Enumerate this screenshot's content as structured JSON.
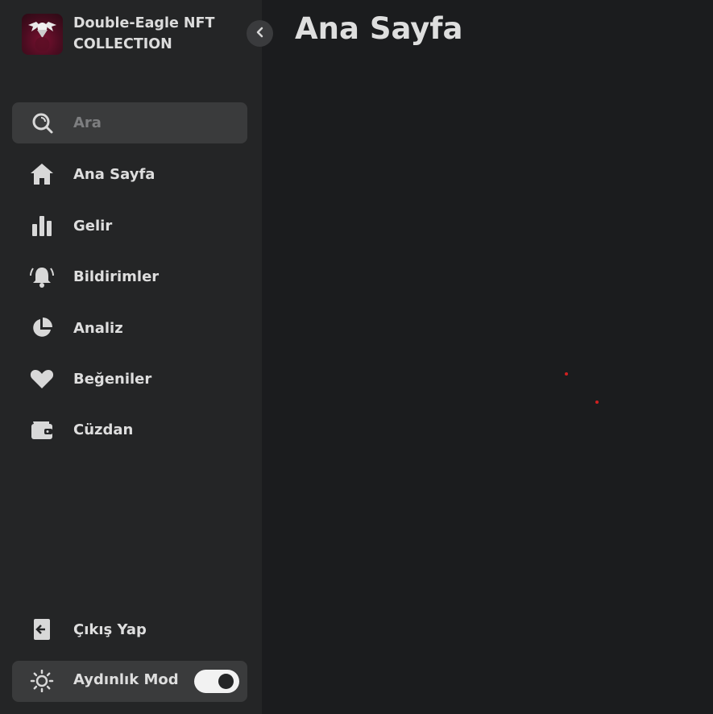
{
  "brand": {
    "name": "Double-Eagle NFT COLLECTION",
    "logo_icon": "double-eagle-logo"
  },
  "sidebar": {
    "collapse_icon": "chevron-left-icon",
    "search": {
      "placeholder": "Ara",
      "value": "",
      "icon": "search-icon"
    },
    "items": [
      {
        "label": "Ana Sayfa",
        "icon": "home-icon"
      },
      {
        "label": "Gelir",
        "icon": "bar-chart-icon"
      },
      {
        "label": "Bildirimler",
        "icon": "bell-icon"
      },
      {
        "label": "Analiz",
        "icon": "pie-chart-icon"
      },
      {
        "label": "Beğeniler",
        "icon": "heart-icon"
      },
      {
        "label": "Cüzdan",
        "icon": "wallet-icon"
      }
    ],
    "logout": {
      "label": "Çıkış Yap",
      "icon": "logout-icon"
    },
    "mode": {
      "label": "Aydınlık Mod",
      "icon": "sun-icon",
      "toggle_on": true
    }
  },
  "main": {
    "title": "Ana Sayfa"
  },
  "colors": {
    "sidebar_bg": "#242526",
    "main_bg": "#1b1c1e",
    "search_bg": "#3a3b3c",
    "text": "#dedede",
    "dot_accent": "#d02020"
  }
}
